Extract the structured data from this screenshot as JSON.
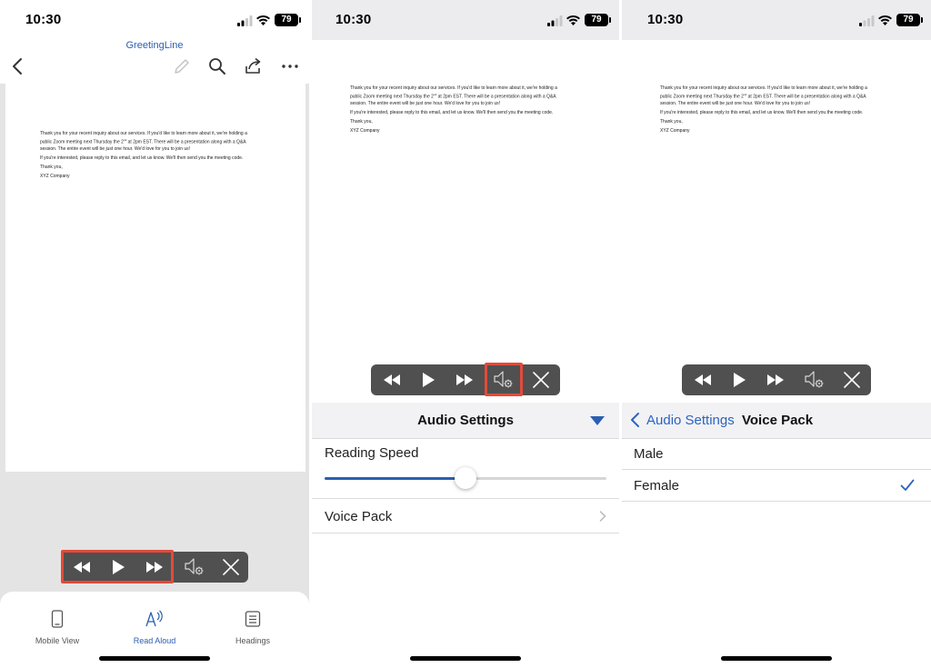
{
  "status_bar": {
    "time": "10:30",
    "battery": "79"
  },
  "panel1": {
    "doc_title": "GreetingLine",
    "tabs": [
      {
        "label": "Mobile View",
        "icon": "phone-icon"
      },
      {
        "label": "Read Aloud",
        "icon": "read-aloud-icon"
      },
      {
        "label": "Headings",
        "icon": "headings-icon"
      }
    ]
  },
  "document": {
    "line1": "Thank you for your recent inquiry about our services. If you'd like to learn more about it, we're holding a",
    "line2a": "public Zoom meeting next Thursday the 2",
    "line2_sup": "nd",
    "line2b": " at 2pm EST. There will be a presentation along with a Q&A",
    "line3": "session. The entire event will be just one hour. We'd love for you to join us!",
    "para2": "If you're interested, please reply to this email, and let us know. We'll then send you the meeting code.",
    "closing": "Thank you,",
    "signature": "XYZ Company"
  },
  "audio_settings": {
    "title": "Audio Settings",
    "reading_speed_label": "Reading Speed",
    "reading_speed_value": 0.5,
    "voice_pack_label": "Voice Pack"
  },
  "voice_pack": {
    "back_label": "Audio Settings",
    "title": "Voice Pack",
    "options": [
      "Male",
      "Female"
    ],
    "selected": "Female"
  },
  "colors": {
    "accent": "#2b5fb1",
    "highlight": "#e34a3a",
    "controller": "#505050"
  }
}
